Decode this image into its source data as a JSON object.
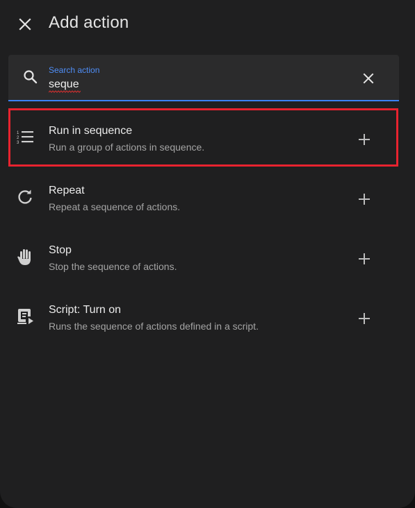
{
  "header": {
    "title": "Add action"
  },
  "search": {
    "label": "Search action",
    "value": "seque"
  },
  "colors": {
    "accent": "#4f8ef7",
    "highlight": "#e8232f",
    "background": "#1f1f20"
  },
  "items": [
    {
      "label": "Run in sequence",
      "description": "Run a group of actions in sequence.",
      "icon": "format-list-numbered-icon",
      "highlighted": true
    },
    {
      "label": "Repeat",
      "description": "Repeat a sequence of actions.",
      "icon": "refresh-icon",
      "highlighted": false
    },
    {
      "label": "Stop",
      "description": "Stop the sequence of actions.",
      "icon": "hand-stop-icon",
      "highlighted": false
    },
    {
      "label": "Script: Turn on",
      "description": "Runs the sequence of actions defined in a script.",
      "icon": "script-play-icon",
      "highlighted": false
    }
  ]
}
